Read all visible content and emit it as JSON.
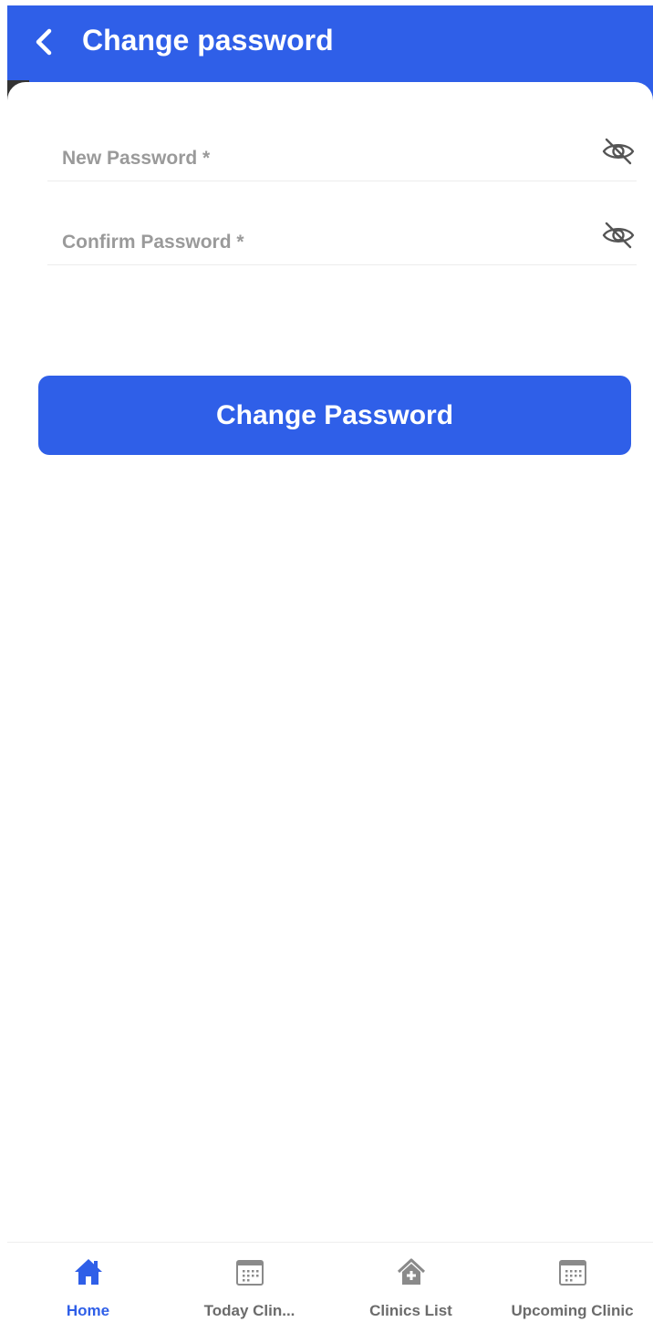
{
  "header": {
    "title": "Change password",
    "back_icon": "chevron-left-icon"
  },
  "colors": {
    "primary": "#2f5fe8",
    "inactive": "#6b6b6b",
    "placeholder": "#9a9a9a"
  },
  "form": {
    "new_password": {
      "placeholder": "New Password *",
      "value": "",
      "toggle_icon": "eye-off-icon"
    },
    "confirm_password": {
      "placeholder": "Confirm Password *",
      "value": "",
      "toggle_icon": "eye-off-icon"
    },
    "submit_label": "Change Password"
  },
  "bottom_nav": {
    "active_index": 0,
    "items": [
      {
        "label": "Home",
        "icon": "home-icon"
      },
      {
        "label": "Today Clin...",
        "icon": "calendar-icon"
      },
      {
        "label": "Clinics List",
        "icon": "clinic-house-icon"
      },
      {
        "label": "Upcoming Clinic",
        "icon": "calendar-icon"
      }
    ]
  }
}
